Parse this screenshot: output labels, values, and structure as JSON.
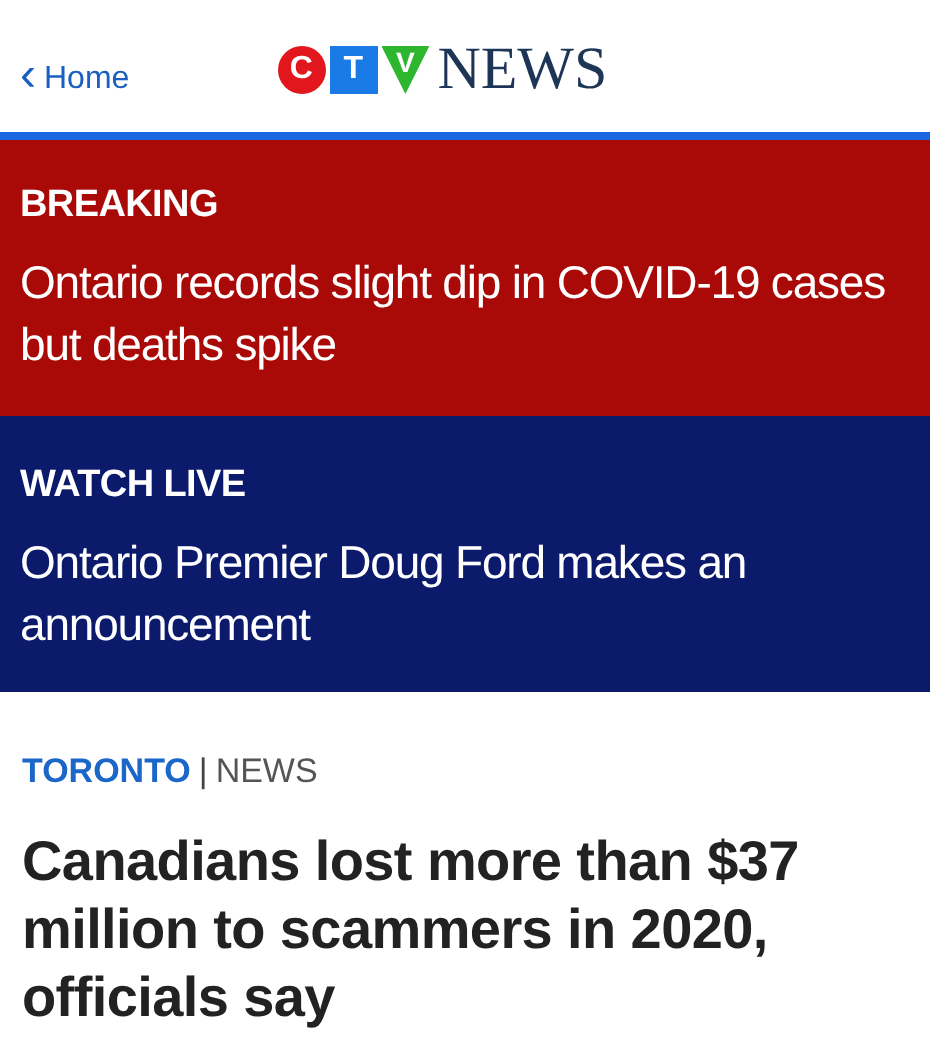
{
  "header": {
    "back_link": "Home",
    "back_icon": "‹",
    "logo": {
      "letters": [
        "C",
        "T",
        "V"
      ],
      "word": "NEWS"
    }
  },
  "banners": [
    {
      "kind": "breaking",
      "label": "BREAKING",
      "headline": "Ontario records slight dip in COVID-19 cases but deaths spike"
    },
    {
      "kind": "live",
      "label": "WATCH LIVE",
      "headline": "Ontario Premier Doug Ford makes an announcement"
    }
  ],
  "article": {
    "region": "TORONTO",
    "separator": "|",
    "section": "NEWS",
    "headline": "Canadians lost more than $37 million to scammers in 2020, officials say"
  }
}
